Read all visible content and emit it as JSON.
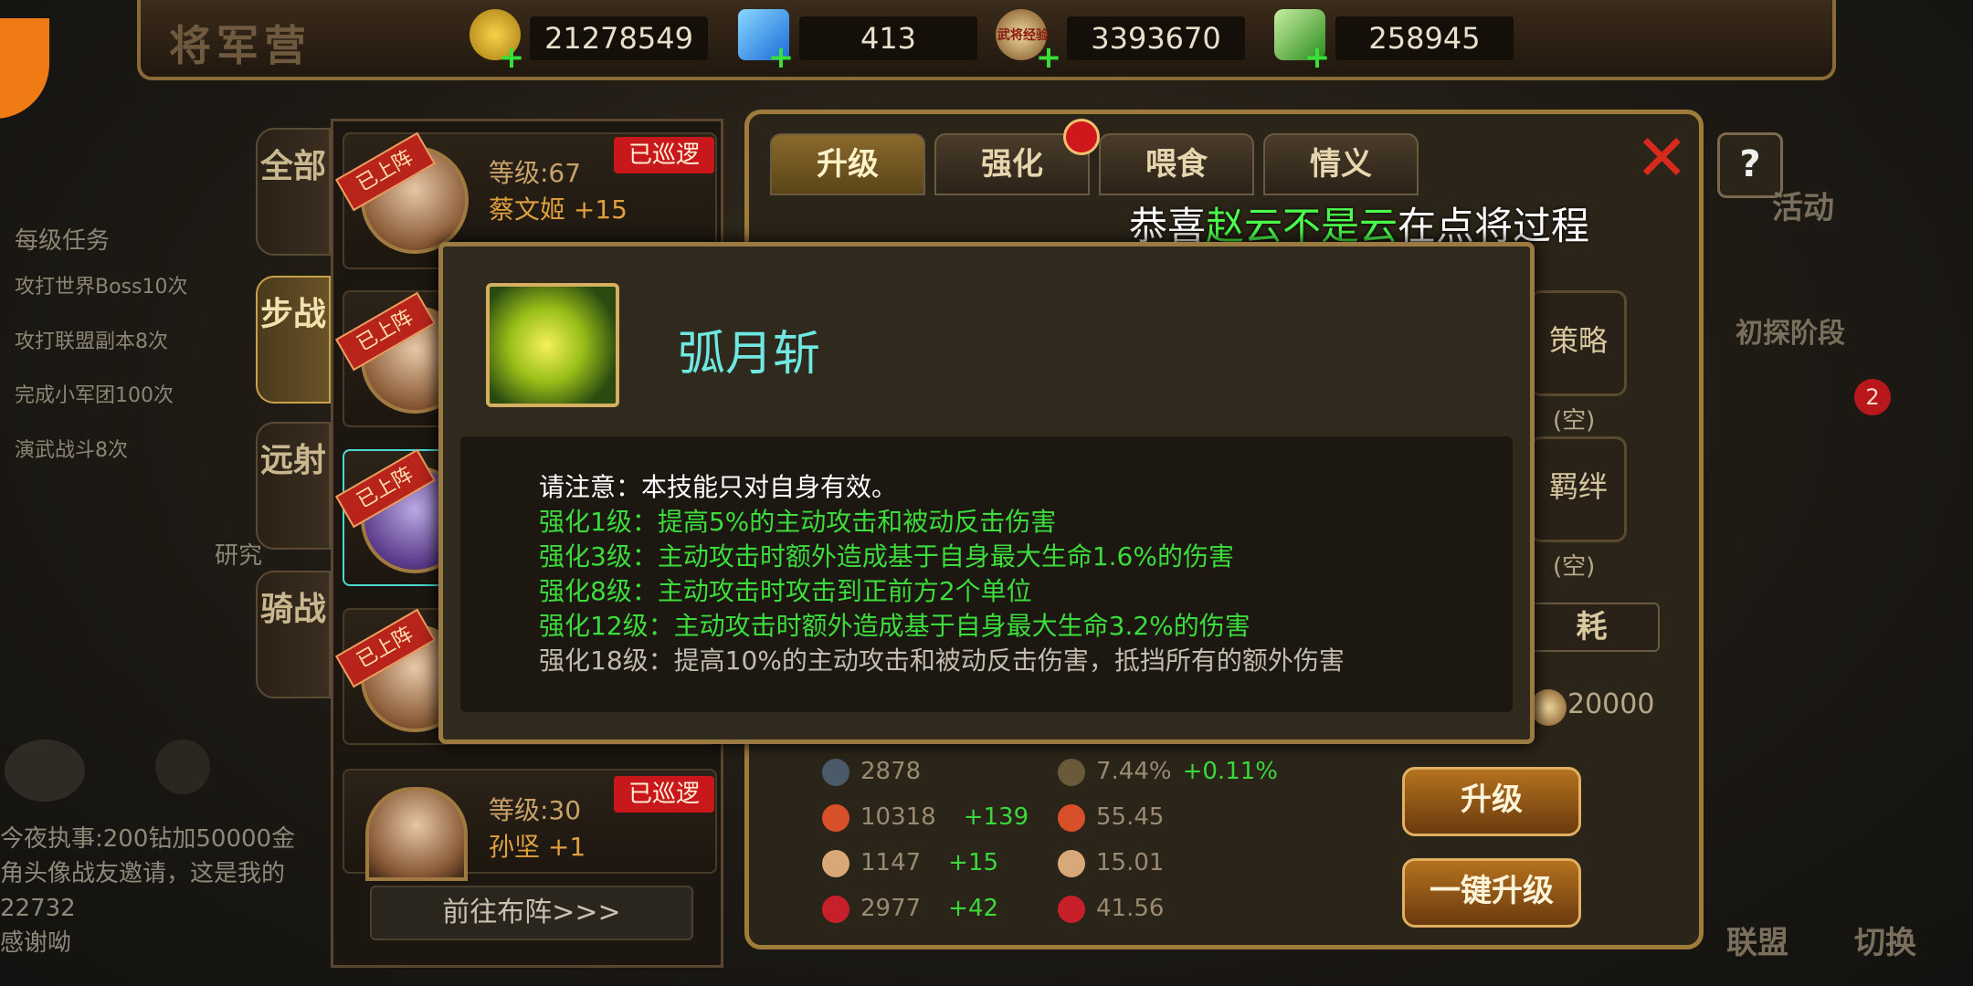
{
  "topbar": {
    "title": "将军营",
    "resources": [
      {
        "icon": "coin-icon",
        "value": "21278549"
      },
      {
        "icon": "gem-icon",
        "value": "413"
      },
      {
        "icon": "general-exp-icon",
        "value": "3393670",
        "icon_label": "武将经验"
      },
      {
        "icon": "potion-icon",
        "value": "258945"
      }
    ]
  },
  "side_tasks": [
    "每级任务",
    "攻打世界Boss10次",
    "攻打联盟副本8次",
    "完成小军团100次",
    "演武战斗8次"
  ],
  "side_misc": {
    "research": "研究"
  },
  "categories": [
    "全部",
    "步战",
    "远射",
    "骑战"
  ],
  "heroes": [
    {
      "badge": "已上阵",
      "level": "等级:67",
      "name": "蔡文姬 +15",
      "patrol": "已巡逻"
    },
    {
      "badge": "已上阵"
    },
    {
      "badge": "已上阵"
    },
    {
      "badge": "已上阵"
    },
    {
      "level": "等级:30",
      "name": "孙坚 +1",
      "patrol": "已巡逻"
    }
  ],
  "goto_button": "前往布阵>>>",
  "tabs": [
    "升级",
    "强化",
    "喂食",
    "情义"
  ],
  "notice": {
    "prefix": "恭喜",
    "player": "赵云不是云",
    "suffix": "在点将过程"
  },
  "slots": [
    {
      "label": "策略",
      "state": "(空)"
    },
    {
      "label": "羁绊",
      "state": "(空)"
    }
  ],
  "cost": {
    "label": "耗",
    "value": "20000"
  },
  "stats": [
    {
      "icon": "armor-icon",
      "value": "2878",
      "inc": "",
      "icon2": "shield-icon",
      "value2": "7.44%",
      "inc2": "+0.11%"
    },
    {
      "icon": "heart-icon",
      "value": "10318",
      "inc": "+139",
      "icon2": "heart-plus-icon",
      "value2": "55.45",
      "inc2": ""
    },
    {
      "icon": "muscle-icon",
      "value": "1147",
      "inc": "+15",
      "icon2": "muscle-plus-icon",
      "value2": "15.01",
      "inc2": ""
    },
    {
      "icon": "glove-icon",
      "value": "2977",
      "inc": "+42",
      "icon2": "glove-plus-icon",
      "value2": "41.56",
      "inc2": ""
    }
  ],
  "buttons": {
    "upgrade": "升级",
    "one_click_upgrade": "一键升级"
  },
  "popup": {
    "skill_name": "弧月斩",
    "note": "请注意：本技能只对自身有效。",
    "levels": [
      "强化1级：提高5%的主动攻击和被动反击伤害",
      "强化3级：主动攻击时额外造成基于自身最大生命1.6%的伤害",
      "强化8级：主动攻击时攻击到正前方2个单位",
      "强化12级：主动攻击时额外造成基于自身最大生命3.2%的伤害",
      "强化18级：提高10%的主动攻击和被动反击伤害，抵挡所有的额外伤害"
    ]
  },
  "chat": {
    "lines": [
      "今夜执事:200钻加50000金",
      "角头像战友邀请，这是我的",
      "22732",
      "感谢呦"
    ]
  },
  "right_side": {
    "activity": "活动",
    "stage": "初探阶段",
    "alliance": "联盟",
    "switch": "切换",
    "badge_count": "2"
  }
}
